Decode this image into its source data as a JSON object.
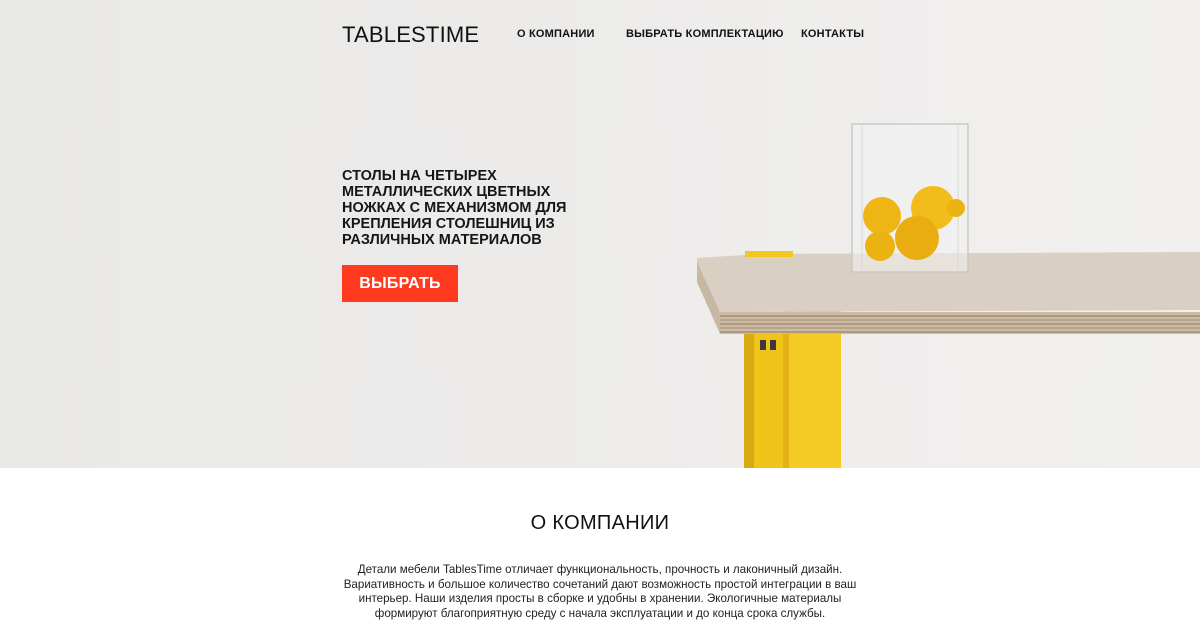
{
  "header": {
    "logo": "TABLESTIME",
    "nav": [
      {
        "label": "О КОМПАНИИ"
      },
      {
        "label": "ВЫБРАТЬ КОМПЛЕКТАЦИЮ"
      },
      {
        "label": "КОНТАКТЫ"
      }
    ]
  },
  "hero": {
    "headline": "СТОЛЫ НА ЧЕТЫРЕХ МЕТАЛЛИЧЕСКИХ ЦВЕТНЫХ НОЖКАХ С МЕХАНИЗМОМ ДЛЯ КРЕПЛЕНИЯ СТОЛЕШНИЦ ИЗ РАЗЛИЧНЫХ МАТЕРИАЛОВ",
    "cta_label": "ВЫБРАТЬ",
    "image": "plywood-table-yellow-legs-glass-vase-lemons"
  },
  "about": {
    "title": "О КОМПАНИИ",
    "text": "Детали мебели TablesTime отличает функциональность, прочность и лаконичный дизайн. Вариативность и большое количество сочетаний дают возможность простой интеграции в ваш интерьер. Наши изделия просты в сборке и удобны в хранении. Экологичные материалы формируют благоприятную среду с начала эксплуатации и до конца срока службы."
  },
  "colors": {
    "accent": "#ff3a1e",
    "leg": "#f2c81e",
    "text": "#111111"
  }
}
